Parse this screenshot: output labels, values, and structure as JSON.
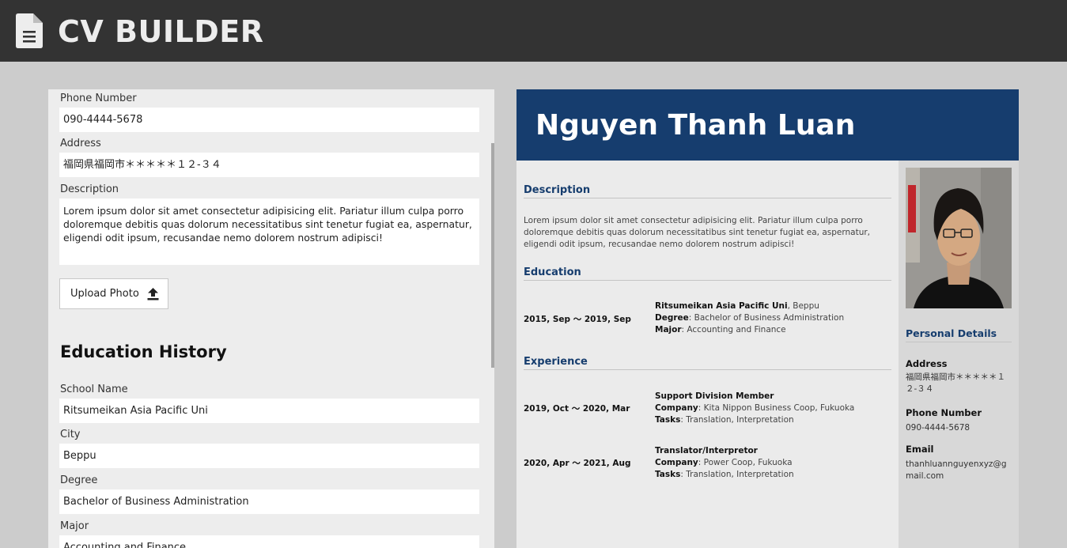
{
  "app": {
    "title": "CV BUILDER",
    "logo_icon": "document-icon",
    "header_color": "#333333"
  },
  "form": {
    "phone_label": "Phone Number",
    "phone_value": "090-4444-5678",
    "address_label": "Address",
    "address_value": "福岡県福岡市＊＊＊＊＊１２-３４",
    "description_label": "Description",
    "description_value": "Lorem ipsum dolor sit amet consectetur adipisicing elit. Pariatur illum culpa porro doloremque debitis quas dolorum necessitatibus sint tenetur fugiat ea, aspernatur, eligendi odit ipsum, recusandae nemo dolorem nostrum adipisci!",
    "upload_label": "Upload Photo",
    "upload_icon": "upload-icon",
    "education_heading": "Education History",
    "school_label": "School Name",
    "school_value": "Ritsumeikan Asia Pacific Uni",
    "city_label": "City",
    "city_value": "Beppu",
    "degree_label": "Degree",
    "degree_value": "Bachelor of Business Administration",
    "major_label": "Major",
    "major_value": "Accounting and Finance"
  },
  "cv": {
    "name": "Nguyen Thanh Luan",
    "accent_color": "#163d6e",
    "description_heading": "Description",
    "description_text": "Lorem ipsum dolor sit amet consectetur adipisicing elit. Pariatur illum culpa porro doloremque debitis quas dolorum necessitatibus sint tenetur fugiat ea, aspernatur, eligendi odit ipsum, recusandae nemo dolorem nostrum adipisci!",
    "education_heading": "Education",
    "education": [
      {
        "dates": "2015, Sep 〜 2019, Sep",
        "school": "Ritsumeikan Asia Pacific Uni",
        "city": ", Beppu",
        "degree_key": "Degree",
        "degree": ": Bachelor of Business Administration",
        "major_key": "Major",
        "major": ": Accounting and Finance"
      }
    ],
    "experience_heading": "Experience",
    "experience": [
      {
        "dates": "2019, Oct 〜 2020, Mar",
        "title": "Support Division Member",
        "company_key": "Company",
        "company": ": Kita Nippon Business Coop, Fukuoka",
        "tasks_key": "Tasks",
        "tasks": ": Translation, Interpretation"
      },
      {
        "dates": "2020, Apr 〜 2021, Aug",
        "title": "Translator/Interpretor",
        "company_key": "Company",
        "company": ": Power Coop, Fukuoka",
        "tasks_key": "Tasks",
        "tasks": ": Translation, Interpretation"
      }
    ],
    "personal_heading": "Personal Details",
    "address_label": "Address",
    "address_value": "福岡県福岡市＊＊＊＊＊１２-３４",
    "phone_label": "Phone Number",
    "phone_value": "090-4444-5678",
    "email_label": "Email",
    "email_value": "thanhluannguyenxyz@gmail.com"
  }
}
